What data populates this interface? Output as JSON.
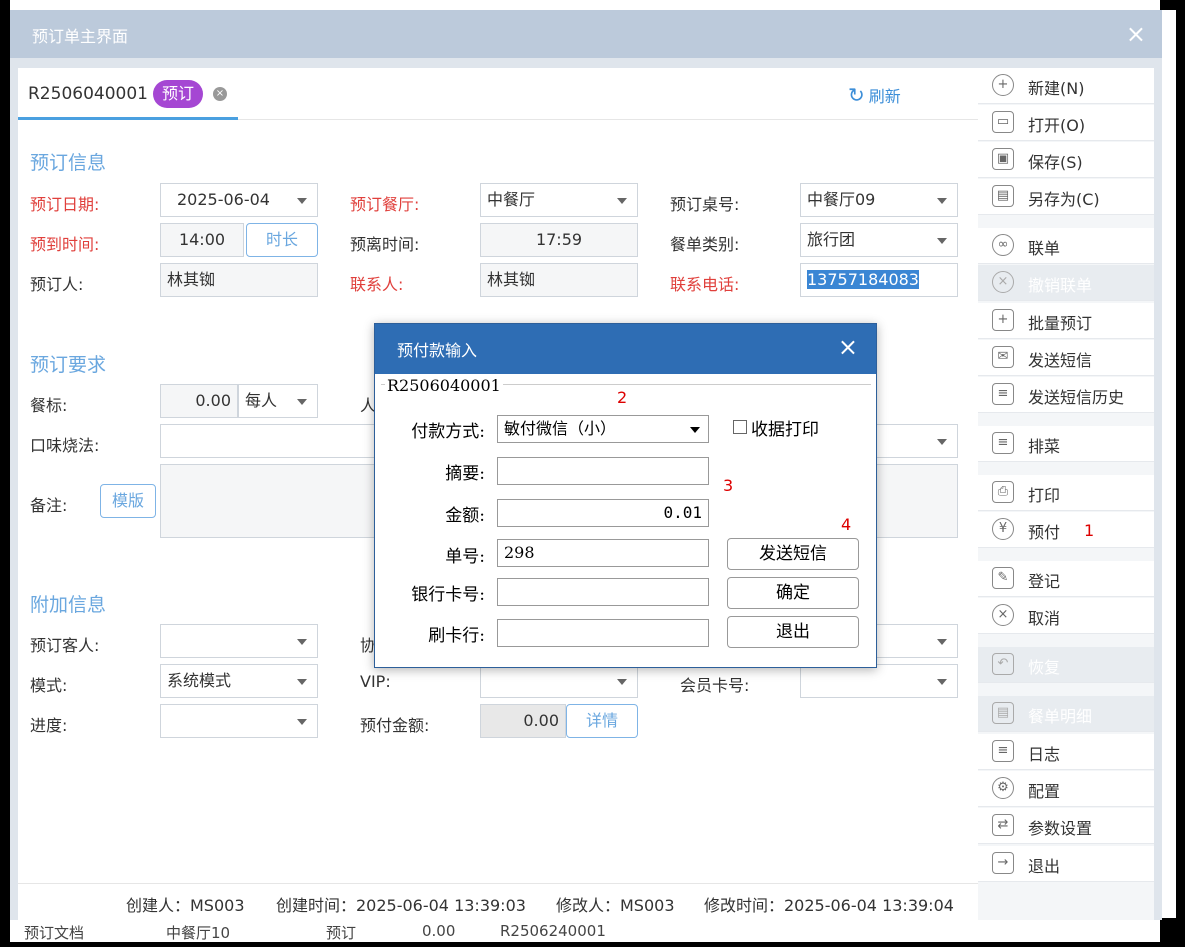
{
  "window": {
    "title": "预订单主界面",
    "close": "×"
  },
  "tab": {
    "code": "R2506040001",
    "badge": "预订",
    "close": "×"
  },
  "refresh": {
    "icon": "↻",
    "label": "刷新"
  },
  "sections": {
    "info": "预订信息",
    "req": "预订要求",
    "extra": "附加信息"
  },
  "info": {
    "date_label": "预订日期:",
    "date_value": "2025-06-04",
    "hall_label": "预订餐厅:",
    "hall_value": "中餐厅",
    "table_label": "预订桌号:",
    "table_value": "中餐厅09",
    "arrive_label": "预到时间:",
    "arrive_value": "14:00",
    "duration_btn": "时长",
    "leave_label": "预离时间:",
    "leave_value": "17:59",
    "category_label": "餐单类别:",
    "category_value": "旅行团",
    "booker_label": "预订人:",
    "booker_value": "林其铷",
    "contact_label": "联系人:",
    "contact_value": "林其铷",
    "phone_label": "联系电话:",
    "phone_value": "13757184083"
  },
  "req": {
    "standard_label": "餐标:",
    "standard_value": "0.00",
    "standard_unit": "每人",
    "people_label": "人",
    "taste_label": "口味烧法:",
    "note_label": "备注:",
    "template_btn": "模版"
  },
  "extra": {
    "guest_label": "预订客人:",
    "agree_label": "协",
    "mode_label": "模式:",
    "mode_value": "系统模式",
    "vip_label": "VIP:",
    "member_label": "会员卡号:",
    "progress_label": "进度:",
    "prepay_label": "预付金额:",
    "prepay_value": "0.00",
    "detail_btn": "详情"
  },
  "status": {
    "creator": "创建人：MS003",
    "created": "创建时间：2025-06-04 13:39:03",
    "modifier": "修改人：MS003",
    "modified": "修改时间：2025-06-04 13:39:04"
  },
  "sidebar": [
    {
      "icon": "+",
      "label": "新建(N)"
    },
    {
      "icon": "▭",
      "label": "打开(O)"
    },
    {
      "icon": "▣",
      "label": "保存(S)"
    },
    {
      "icon": "▤",
      "label": "另存为(C)"
    },
    {
      "icon": "∞",
      "label": "联单"
    },
    {
      "icon": "×",
      "label": "撤销联单"
    },
    {
      "icon": "+",
      "label": "批量预订"
    },
    {
      "icon": "✉",
      "label": "发送短信"
    },
    {
      "icon": "≡",
      "label": "发送短信历史"
    },
    {
      "icon": "≡",
      "label": "排菜"
    },
    {
      "icon": "⎙",
      "label": "打印"
    },
    {
      "icon": "¥",
      "label": "预付"
    },
    {
      "icon": "✎",
      "label": "登记"
    },
    {
      "icon": "×",
      "label": "取消"
    },
    {
      "icon": "↶",
      "label": "恢复"
    },
    {
      "icon": "▤",
      "label": "餐单明细"
    },
    {
      "icon": "≡",
      "label": "日志"
    },
    {
      "icon": "⚙",
      "label": "配置"
    },
    {
      "icon": "⇄",
      "label": "参数设置"
    },
    {
      "icon": "→",
      "label": "退出"
    }
  ],
  "annotations": {
    "n1": "1",
    "n2": "2",
    "n3": "3",
    "n4": "4"
  },
  "dialog": {
    "title": "预付款输入",
    "close": "×",
    "legend": "R2506040001",
    "pay_label": "付款方式:",
    "pay_value": "敏付微信（小）",
    "receipt_label": "收据打印",
    "summary_label": "摘要:",
    "summary_value": "",
    "amount_label": "金额:",
    "amount_value": "0.01",
    "order_label": "单号:",
    "order_value": "298",
    "card_label": "银行卡号:",
    "card_value": "",
    "bank_label": "刷卡行:",
    "bank_value": "",
    "sms_btn": "发送短信",
    "ok_btn": "确定",
    "exit_btn": "退出"
  },
  "background": {
    "row_text_1": "预订文档",
    "row_text_2": "中餐厅10",
    "row_text_3": "预订",
    "row_text_4": "0.00",
    "row_text_5": "R2506240001"
  }
}
